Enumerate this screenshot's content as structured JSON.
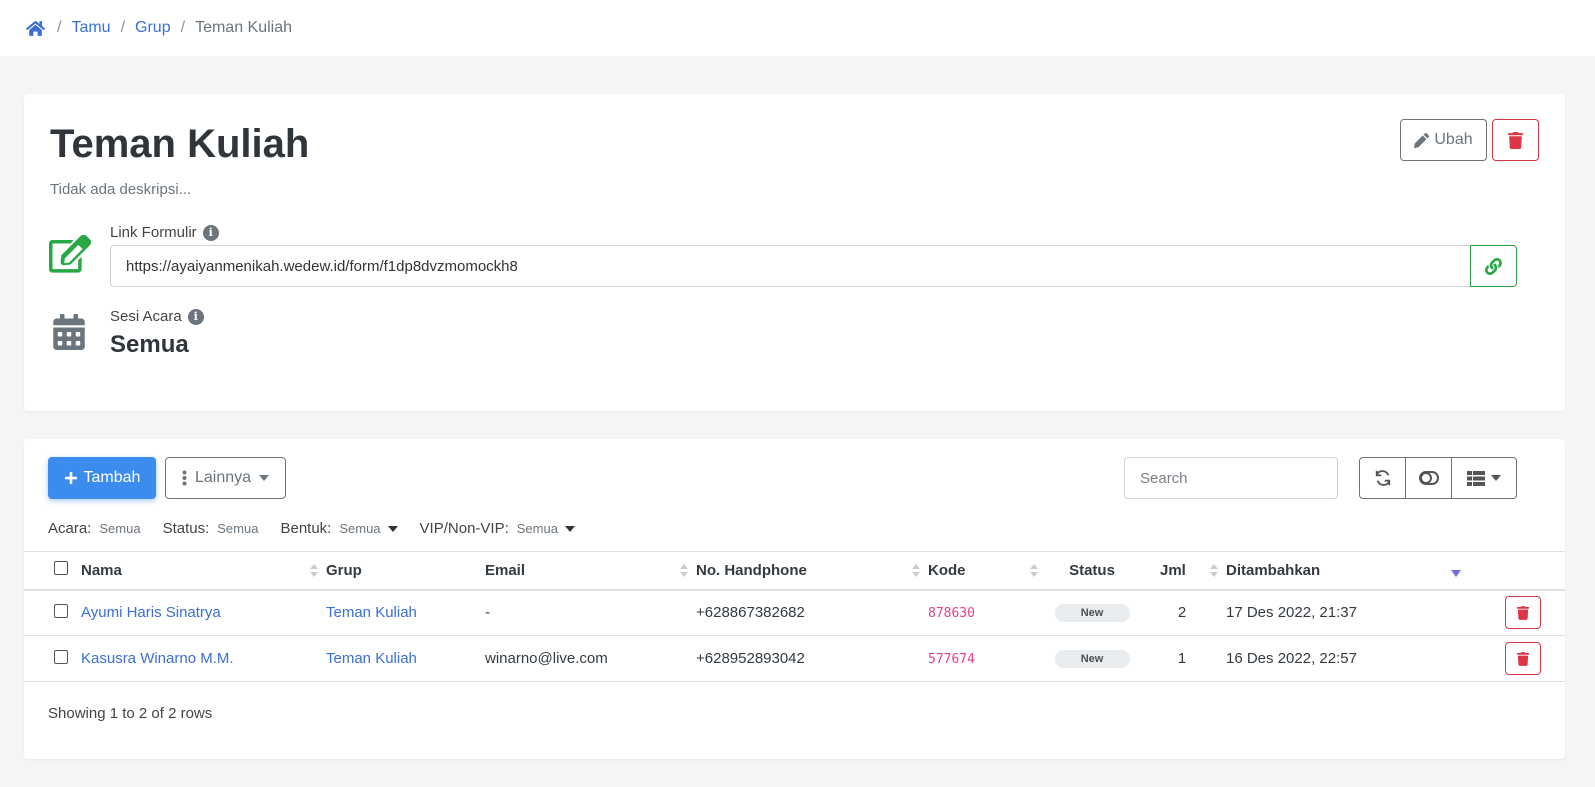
{
  "breadcrumb": {
    "items": [
      "Tamu",
      "Grup"
    ],
    "current": "Teman Kuliah"
  },
  "group": {
    "title": "Teman Kuliah",
    "description": "Tidak ada deskripsi...",
    "edit_label": "Ubah",
    "form_link_label": "Link Formulir",
    "form_link_value": "https://ayaiyanmenikah.wedew.id/form/f1dp8dvzmomockh8",
    "session_label": "Sesi Acara",
    "session_value": "Semua"
  },
  "toolbar": {
    "add_label": "Tambah",
    "more_label": "Lainnya",
    "search_placeholder": "Search"
  },
  "filters": [
    {
      "key": "Acara:",
      "value": "Semua",
      "dropdown": false
    },
    {
      "key": "Status:",
      "value": "Semua",
      "dropdown": false
    },
    {
      "key": "Bentuk:",
      "value": "Semua",
      "dropdown": true
    },
    {
      "key": "VIP/Non-VIP:",
      "value": "Semua",
      "dropdown": true
    }
  ],
  "table": {
    "columns": [
      "Nama",
      "Grup",
      "Email",
      "No. Handphone",
      "Kode",
      "Status",
      "Jml",
      "Ditambahkan"
    ],
    "rows": [
      {
        "nama": "Ayumi Haris Sinatrya",
        "grup": "Teman Kuliah",
        "email": "-",
        "phone": "+628867382682",
        "kode": "878630",
        "status": "New",
        "jml": "2",
        "added": "17 Des 2022, 21:37"
      },
      {
        "nama": "Kasusra Winarno M.M.",
        "grup": "Teman Kuliah",
        "email": "winarno@live.com",
        "phone": "+628952893042",
        "kode": "577674",
        "status": "New",
        "jml": "1",
        "added": "16 Des 2022, 22:57"
      }
    ]
  },
  "pagination": {
    "text": "Showing 1 to 2 of 2 rows"
  },
  "colors": {
    "primary": "#3c8cf0",
    "link": "#3a6fd8",
    "danger": "#dc3545",
    "success": "#28a745",
    "code": "#e83e8c"
  }
}
